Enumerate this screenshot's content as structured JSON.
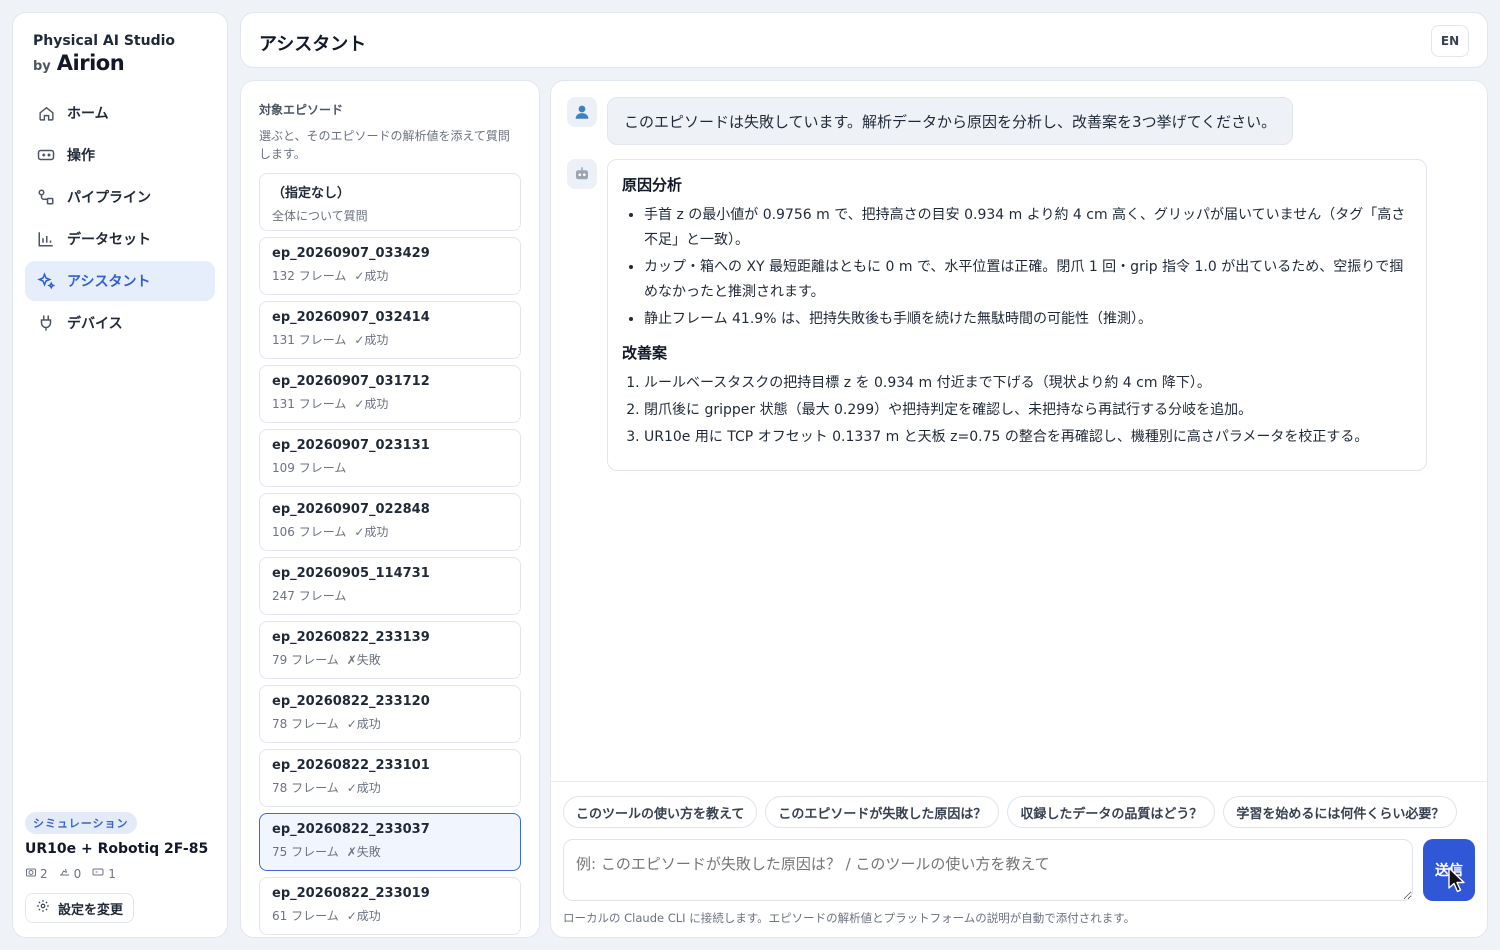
{
  "brand": {
    "name": "Physical AI Studio",
    "by": "by",
    "logo": "Airion"
  },
  "nav": [
    {
      "label": "ホーム",
      "icon": "home-icon"
    },
    {
      "label": "操作",
      "icon": "gamepad-icon"
    },
    {
      "label": "パイプライン",
      "icon": "pipeline-icon"
    },
    {
      "label": "データセット",
      "icon": "chart-icon"
    },
    {
      "label": "アシスタント",
      "icon": "sparkles-icon",
      "active": true
    },
    {
      "label": "デバイス",
      "icon": "plug-icon"
    }
  ],
  "sidebar_footer": {
    "badge": "シミュレーション",
    "robot": "UR10e + Robotiq 2F-85",
    "stats": {
      "cameras": "2",
      "arms": "0",
      "controllers": "1"
    },
    "settings_label": "設定を変更"
  },
  "header": {
    "title": "アシスタント",
    "lang": "EN"
  },
  "episodes": {
    "heading": "対象エピソード",
    "description": "選ぶと、そのエピソードの解析値を添えて質問します。",
    "none": {
      "title": "（指定なし）",
      "subtitle": "全体について質問"
    },
    "items": [
      {
        "name": "ep_20260907_033429",
        "frames": "132 フレーム",
        "status": "✓成功"
      },
      {
        "name": "ep_20260907_032414",
        "frames": "131 フレーム",
        "status": "✓成功"
      },
      {
        "name": "ep_20260907_031712",
        "frames": "131 フレーム",
        "status": "✓成功"
      },
      {
        "name": "ep_20260907_023131",
        "frames": "109 フレーム",
        "status": ""
      },
      {
        "name": "ep_20260907_022848",
        "frames": "106 フレーム",
        "status": "✓成功"
      },
      {
        "name": "ep_20260905_114731",
        "frames": "247 フレーム",
        "status": ""
      },
      {
        "name": "ep_20260822_233139",
        "frames": "79 フレーム",
        "status": "✗失敗"
      },
      {
        "name": "ep_20260822_233120",
        "frames": "78 フレーム",
        "status": "✓成功"
      },
      {
        "name": "ep_20260822_233101",
        "frames": "78 フレーム",
        "status": "✓成功"
      },
      {
        "name": "ep_20260822_233037",
        "frames": "75 フレーム",
        "status": "✗失敗",
        "selected": true
      },
      {
        "name": "ep_20260822_233019",
        "frames": "61 フレーム",
        "status": "✓成功"
      }
    ]
  },
  "chat": {
    "user_message": "このエピソードは失敗しています。解析データから原因を分析し、改善案を3つ挙げてください。",
    "response": {
      "heading1": "原因分析",
      "bullets": [
        "手首 z の最小値が 0.9756 m で、把持高さの目安 0.934 m より約 4 cm 高く、グリッパが届いていません（タグ「高さ不足」と一致）。",
        "カップ・箱への XY 最短距離はともに 0 m で、水平位置は正確。閉爪 1 回・grip 指令 1.0 が出ているため、空振りで掴めなかったと推測されます。",
        "静止フレーム 41.9% は、把持失敗後も手順を続けた無駄時間の可能性（推測）。"
      ],
      "heading2": "改善案",
      "steps": [
        "ルールベースタスクの把持目標 z を 0.934 m 付近まで下げる（現状より約 4 cm 降下）。",
        "閉爪後に gripper 状態（最大 0.299）や把持判定を確認し、未把持なら再試行する分岐を追加。",
        "UR10e 用に TCP オフセット 0.1337 m と天板 z=0.75 の整合を再確認し、機種別に高さパラメータを校正する。"
      ]
    },
    "suggestions": [
      "このツールの使い方を教えて",
      "このエピソードが失敗した原因は？",
      "収録したデータの品質はどう？",
      "学習を始めるには何件くらい必要？"
    ],
    "input_placeholder": "例: このエピソードが失敗した原因は？ / このツールの使い方を教えて",
    "send_label": "送信",
    "note": "ローカルの Claude CLI に接続します。エピソードの解析値とプラットフォームの説明が自動で添付されます。"
  }
}
